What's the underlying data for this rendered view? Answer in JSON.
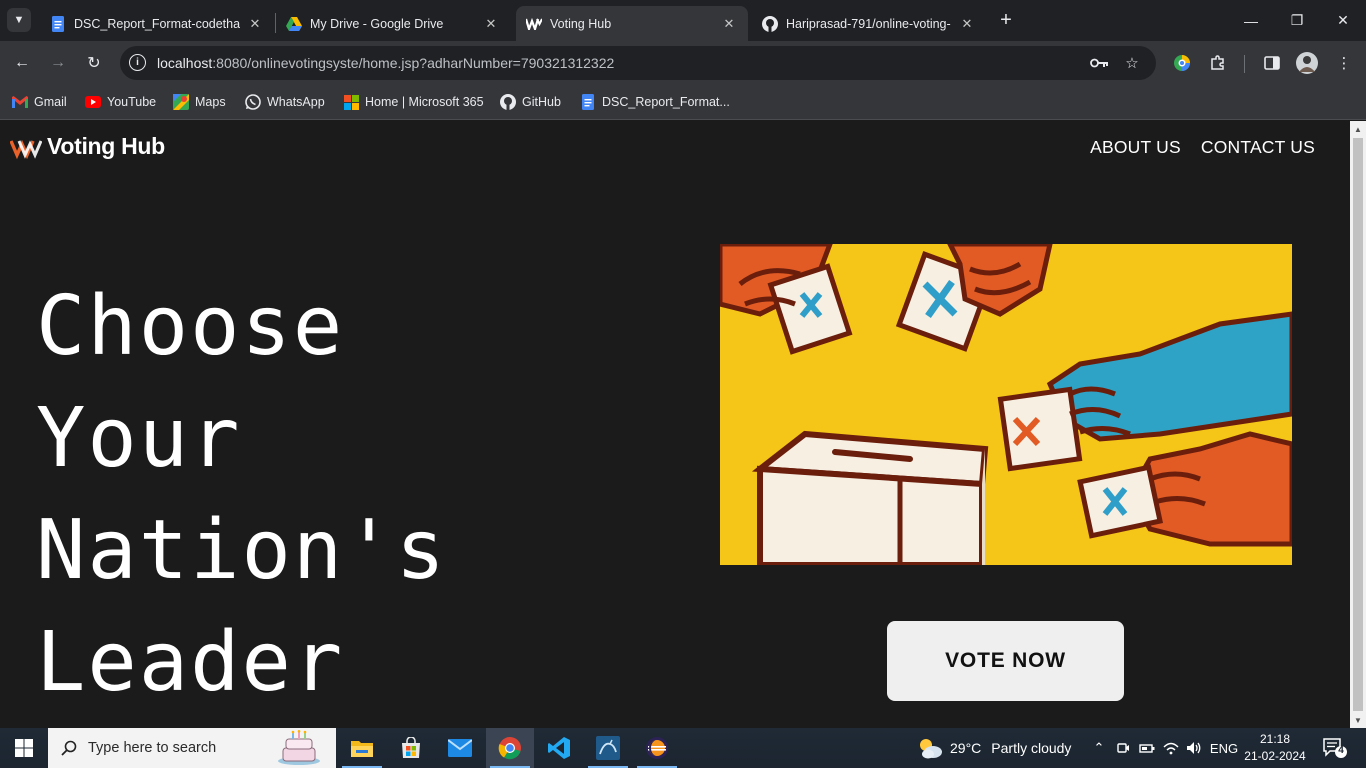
{
  "browser": {
    "tabs": [
      {
        "title": "DSC_Report_Format-codethan-",
        "favicon": "google-docs-icon",
        "active": false
      },
      {
        "title": "My Drive - Google Drive",
        "favicon": "google-drive-icon",
        "active": false
      },
      {
        "title": "Voting Hub",
        "favicon": "voting-hub-icon",
        "active": true
      },
      {
        "title": "Hariprasad-791/online-voting-",
        "favicon": "github-icon",
        "active": false
      }
    ],
    "url": {
      "host": "localhost",
      "rest": ":8080/onlinevotingsyste/home.jsp?adharNumber=790321312322"
    },
    "bookmarks": [
      {
        "label": "Gmail",
        "icon": "gmail-icon"
      },
      {
        "label": "YouTube",
        "icon": "youtube-icon"
      },
      {
        "label": "Maps",
        "icon": "maps-icon"
      },
      {
        "label": "WhatsApp",
        "icon": "whatsapp-icon"
      },
      {
        "label": "Home | Microsoft 365",
        "icon": "microsoft-icon"
      },
      {
        "label": "GitHub",
        "icon": "github-icon"
      },
      {
        "label": "DSC_Report_Format...",
        "icon": "google-docs-icon"
      }
    ]
  },
  "site": {
    "brand": "Voting Hub",
    "nav": [
      {
        "label": "ABOUT US"
      },
      {
        "label": "CONTACT US"
      }
    ],
    "headline_lines": [
      "Choose",
      "Your",
      "Nation's",
      "Leader"
    ],
    "cta_label": "VOTE NOW",
    "colors": {
      "background": "#1b1b1b",
      "text": "#ffffff",
      "button_bg": "#efefef",
      "logo_accent": "#e8622a",
      "illustration_bg": "#f5c518"
    }
  },
  "taskbar": {
    "search_placeholder": "Type here to search",
    "weather": {
      "temp": "29°C",
      "condition": "Partly cloudy"
    },
    "language": "ENG",
    "time": "21:18",
    "date": "21-02-2024",
    "notification_count": "4",
    "apps": [
      "file-explorer-icon",
      "microsoft-store-icon",
      "mail-icon",
      "chrome-icon",
      "vscode-icon",
      "mysql-workbench-icon",
      "eclipse-icon"
    ]
  }
}
